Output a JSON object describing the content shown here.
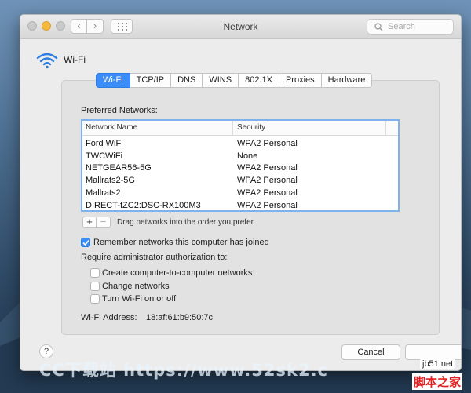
{
  "window": {
    "title": "Network",
    "search_placeholder": "Search",
    "back_glyph": "‹",
    "forward_glyph": "›"
  },
  "header": {
    "label": "Wi-Fi",
    "icon": "wifi-icon"
  },
  "tabs": [
    {
      "label": "Wi-Fi",
      "active": true
    },
    {
      "label": "TCP/IP"
    },
    {
      "label": "DNS"
    },
    {
      "label": "WINS"
    },
    {
      "label": "802.1X"
    },
    {
      "label": "Proxies"
    },
    {
      "label": "Hardware"
    }
  ],
  "preferred": {
    "title": "Preferred Networks:",
    "columns": [
      "Network Name",
      "Security"
    ],
    "rows": [
      {
        "name": "Ford WiFi",
        "security": "WPA2 Personal"
      },
      {
        "name": "TWCWiFi",
        "security": "None"
      },
      {
        "name": "NETGEAR56-5G",
        "security": "WPA2 Personal"
      },
      {
        "name": "Mallrats2-5G",
        "security": "WPA2 Personal"
      },
      {
        "name": "Mallrats2",
        "security": "WPA2 Personal"
      },
      {
        "name": "DIRECT-fZC2:DSC-RX100M3",
        "security": "WPA2 Personal"
      }
    ],
    "add_label": "+",
    "remove_label": "−",
    "drag_hint": "Drag networks into the order you prefer."
  },
  "options": {
    "remember": {
      "label": "Remember networks this computer has joined",
      "checked": true
    },
    "require_title": "Require administrator authorization to:",
    "items": [
      {
        "label": "Create computer-to-computer networks",
        "checked": false
      },
      {
        "label": "Change networks",
        "checked": false
      },
      {
        "label": "Turn Wi-Fi on or off",
        "checked": false
      }
    ]
  },
  "address": {
    "label": "Wi-Fi Address:",
    "value": "18:af:61:b9:50:7c"
  },
  "footer": {
    "help_label": "?",
    "cancel_label": "Cancel"
  },
  "watermarks": {
    "left_text": "CC下载站 https://www.52sk2.c",
    "right_url": "jb51.net",
    "right_text": "脚本之家"
  },
  "colors": {
    "accent": "#3b8ef7",
    "minimize_light": "#f5b93c"
  }
}
